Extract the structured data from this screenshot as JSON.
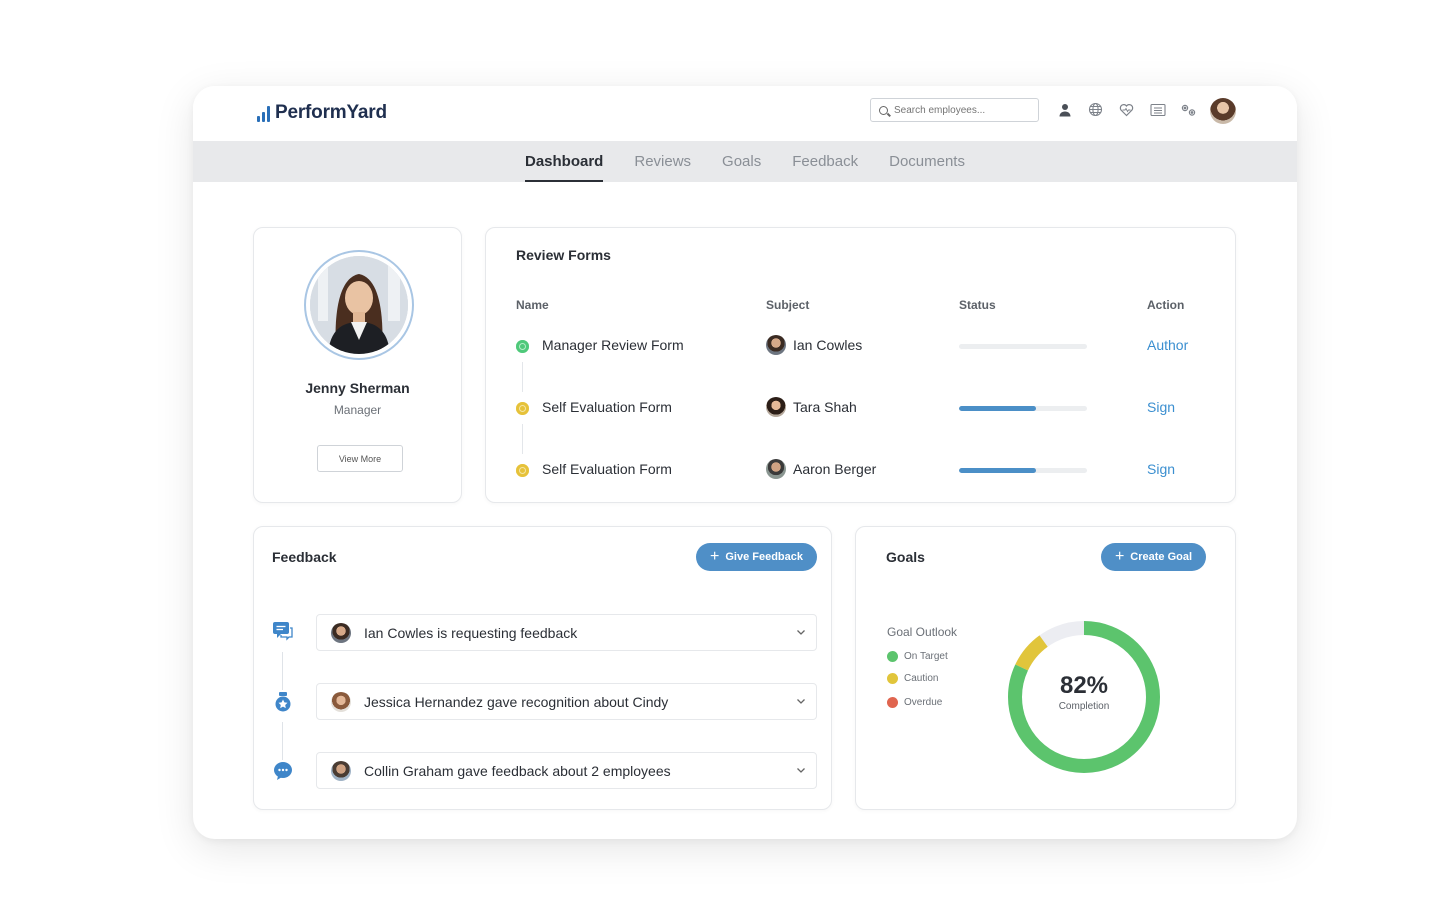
{
  "app": {
    "brand": "PerformYard",
    "search_placeholder": "Search employees..."
  },
  "header_icons": [
    "person-icon",
    "globe-icon",
    "heart-icon",
    "list-icon",
    "gears-icon"
  ],
  "nav": {
    "tabs": [
      {
        "label": "Dashboard",
        "active": true
      },
      {
        "label": "Reviews",
        "active": false
      },
      {
        "label": "Goals",
        "active": false
      },
      {
        "label": "Feedback",
        "active": false
      },
      {
        "label": "Documents",
        "active": false
      }
    ]
  },
  "profile": {
    "name": "Jenny Sherman",
    "role": "Manager",
    "button": "View More"
  },
  "reviews": {
    "title": "Review Forms",
    "columns": {
      "name": "Name",
      "subject": "Subject",
      "status": "Status",
      "action": "Action"
    },
    "rows": [
      {
        "name": "Manager Review Form",
        "subject": "Ian Cowles",
        "progress": 0,
        "action": "Author",
        "state": "green"
      },
      {
        "name": "Self Evaluation Form",
        "subject": "Tara Shah",
        "progress": 0.6,
        "action": "Sign",
        "state": "yellow"
      },
      {
        "name": "Self Evaluation Form",
        "subject": "Aaron Berger",
        "progress": 0.6,
        "action": "Sign",
        "state": "yellow"
      }
    ]
  },
  "feedback": {
    "title": "Feedback",
    "button": "Give Feedback",
    "items": [
      {
        "text": "Ian Cowles is requesting feedback",
        "icon": "chat-request-icon"
      },
      {
        "text": "Jessica Hernandez gave recognition about Cindy",
        "icon": "award-badge-icon"
      },
      {
        "text": "Collin Graham gave feedback about 2 employees",
        "icon": "speech-bubble-icon"
      }
    ]
  },
  "goals": {
    "title": "Goals",
    "button": "Create Goal",
    "outlook_title": "Goal Outlook",
    "legend": [
      {
        "label": "On Target",
        "color": "#5cc46d"
      },
      {
        "label": "Caution",
        "color": "#e1c53b"
      },
      {
        "label": "Overdue",
        "color": "#e0654f"
      }
    ],
    "completion_value": "82%",
    "completion_label": "Completion",
    "completion_fraction": 0.82,
    "caution_fraction": 0.08
  },
  "colors": {
    "accent": "#4f8fc7",
    "link": "#3b8fd0",
    "on_target": "#5cc46d",
    "caution": "#e1c53b",
    "overdue": "#e0654f"
  }
}
